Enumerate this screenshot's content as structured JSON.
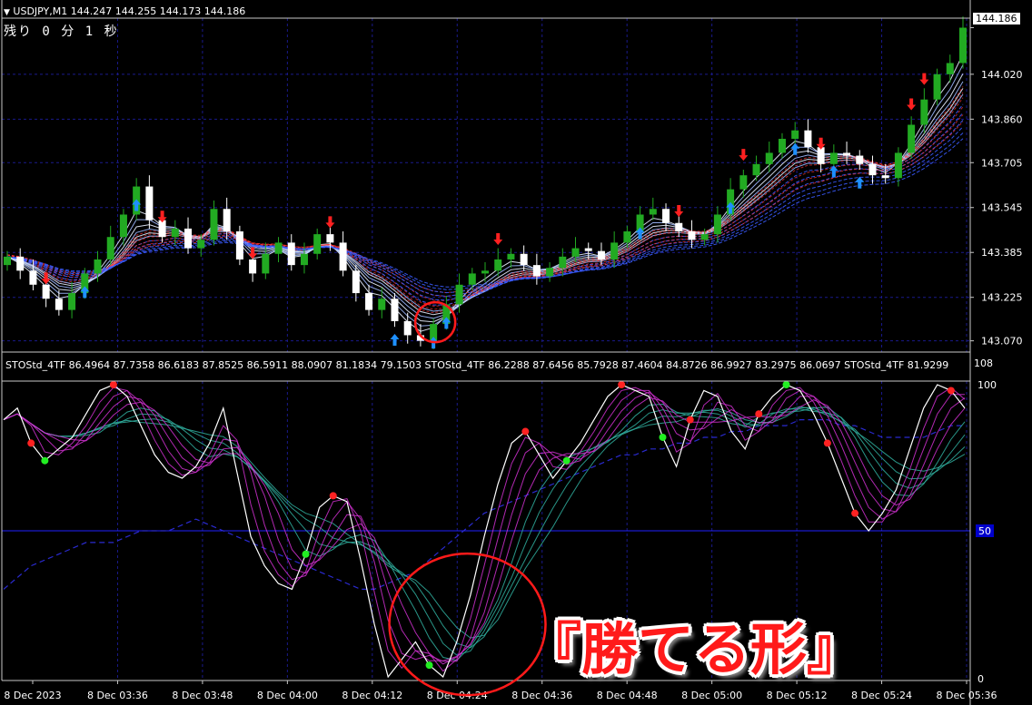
{
  "header": {
    "symbol_line": "USDJPY,M1  144.247 144.255 144.173 144.186",
    "timer": "残り 0 分 1 秒"
  },
  "indicator_header": {
    "text": "STOStd_4TF 86.4964 87.7358 86.6183 87.8525 86.5911 88.0907 81.1834 79.1503  STOStd_4TF 86.2288 87.6456 85.7928 87.4604 84.8726 86.9927 83.2975 86.0697  STOStd_4TF 81.9299"
  },
  "caption": "『勝てる形』",
  "colors": {
    "bull_candle": "#22aa22",
    "bear_candle": "#ffffff",
    "grid": "#1a1a8c",
    "up_arrow": "#1e90ff",
    "down_arrow": "#ff2020",
    "circle": "#ff1a1a",
    "ribbon_red": "#ff3333",
    "ribbon_blue": "#3a5bff",
    "osc_magenta": "#d030d0",
    "osc_teal": "#30b0a0"
  },
  "chart_data": [
    {
      "type": "candlestick",
      "title": "USDJPY,M1",
      "y_ticks": [
        "144.186",
        "144.020",
        "143.860",
        "143.705",
        "143.545",
        "143.385",
        "143.225",
        "143.070"
      ],
      "ylim": [
        143.03,
        144.22
      ],
      "current_price": "144.186",
      "x_ticks": [
        "8 Dec 2023",
        "8 Dec 03:36",
        "8 Dec 03:48",
        "8 Dec 04:00",
        "8 Dec 04:12",
        "8 Dec 04:24",
        "8 Dec 04:36",
        "8 Dec 04:48",
        "8 Dec 05:00",
        "8 Dec 05:12",
        "8 Dec 05:24",
        "8 Dec 05:36"
      ],
      "close_path": [
        143.37,
        143.32,
        143.27,
        143.22,
        143.18,
        143.24,
        143.31,
        143.36,
        143.44,
        143.52,
        143.62,
        143.5,
        143.44,
        143.47,
        143.4,
        143.43,
        143.54,
        143.46,
        143.36,
        143.31,
        143.38,
        143.42,
        143.34,
        143.38,
        143.45,
        143.42,
        143.32,
        143.24,
        143.18,
        143.22,
        143.14,
        143.09,
        143.07,
        143.13,
        143.2,
        143.27,
        143.31,
        143.32,
        143.36,
        143.38,
        143.34,
        143.3,
        143.33,
        143.37,
        143.4,
        143.39,
        143.36,
        143.42,
        143.46,
        143.52,
        143.54,
        143.49,
        143.46,
        143.43,
        143.45,
        143.52,
        143.61,
        143.66,
        143.7,
        143.74,
        143.79,
        143.82,
        143.76,
        143.7,
        143.74,
        143.73,
        143.7,
        143.66,
        143.65,
        143.74,
        143.84,
        143.93,
        144.02,
        144.06,
        144.186
      ],
      "up_arrows": [
        6,
        10,
        30,
        33,
        34,
        49,
        56,
        61,
        64,
        66
      ],
      "down_arrows": [
        3,
        12,
        19,
        25,
        38,
        52,
        57,
        63,
        70,
        71
      ],
      "highlight_index": 33
    },
    {
      "type": "line",
      "title": "STOStd_4TF",
      "y_tick_top": "100",
      "y_tick_mid": "50",
      "y_tick_bottom": "0",
      "y_label_above": "108",
      "ylim": [
        0,
        100
      ],
      "level": 50,
      "fast_line": [
        88,
        92,
        80,
        74,
        78,
        82,
        90,
        98,
        100,
        96,
        86,
        76,
        70,
        68,
        72,
        80,
        92,
        70,
        48,
        38,
        32,
        30,
        42,
        58,
        62,
        60,
        40,
        18,
        0,
        6,
        12,
        4,
        0,
        12,
        28,
        48,
        66,
        80,
        84,
        76,
        68,
        74,
        80,
        88,
        96,
        100,
        98,
        96,
        82,
        72,
        88,
        98,
        96,
        84,
        78,
        90,
        96,
        100,
        98,
        90,
        80,
        68,
        56,
        50,
        56,
        64,
        78,
        92,
        100,
        98,
        92
      ],
      "slow_line": [
        30,
        34,
        38,
        40,
        42,
        44,
        46,
        46,
        46,
        48,
        50,
        50,
        50,
        52,
        54,
        52,
        50,
        48,
        46,
        44,
        42,
        40,
        38,
        36,
        34,
        32,
        30,
        30,
        32,
        34,
        36,
        40,
        44,
        48,
        52,
        56,
        58,
        60,
        62,
        64,
        66,
        68,
        70,
        72,
        74,
        76,
        76,
        78,
        78,
        80,
        80,
        82,
        82,
        84,
        84,
        86,
        86,
        86,
        88,
        88,
        88,
        86,
        86,
        84,
        82,
        82,
        82,
        82,
        84,
        86,
        86
      ],
      "green_dots": [
        3,
        22,
        31,
        41,
        48,
        57
      ],
      "red_dots": [
        2,
        8,
        24,
        38,
        45,
        50,
        55,
        60,
        62,
        69
      ],
      "highlight_index": 31
    }
  ]
}
